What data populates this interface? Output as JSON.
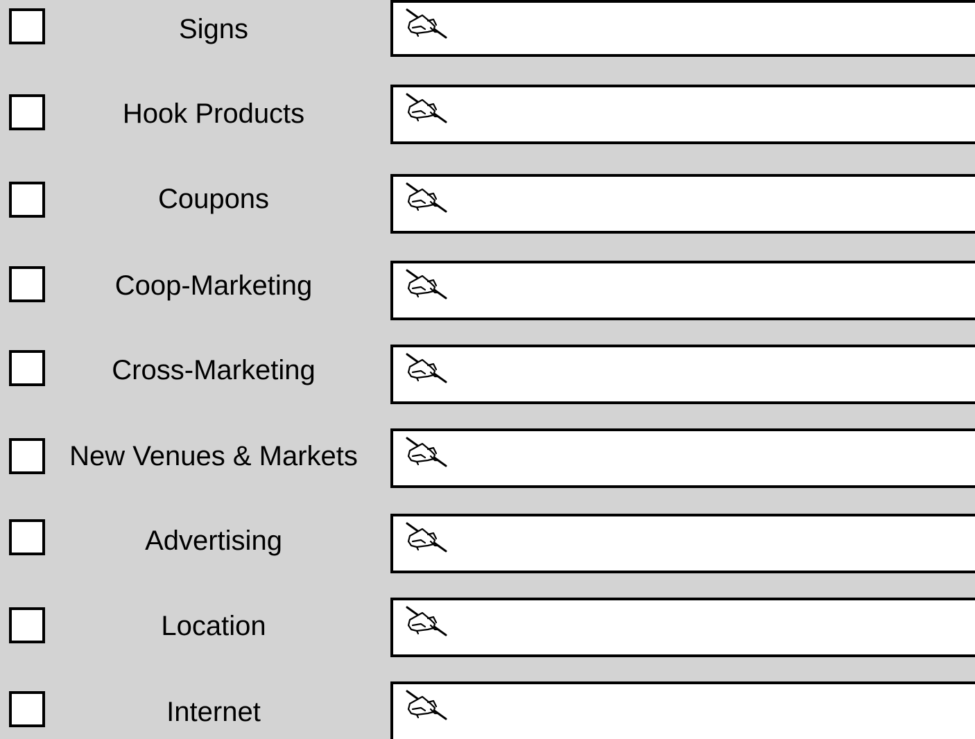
{
  "items": [
    {
      "label": "Signs",
      "checked": false,
      "value": ""
    },
    {
      "label": "Hook Products",
      "checked": false,
      "value": ""
    },
    {
      "label": "Coupons",
      "checked": false,
      "value": ""
    },
    {
      "label": "Coop-Marketing",
      "checked": false,
      "value": ""
    },
    {
      "label": "Cross-Marketing",
      "checked": false,
      "value": ""
    },
    {
      "label": "New Venues & Markets",
      "checked": false,
      "value": ""
    },
    {
      "label": "Advertising",
      "checked": false,
      "value": ""
    },
    {
      "label": "Location",
      "checked": false,
      "value": ""
    },
    {
      "label": "Internet",
      "checked": false,
      "value": ""
    }
  ],
  "field_icon": "writing-hand-icon"
}
